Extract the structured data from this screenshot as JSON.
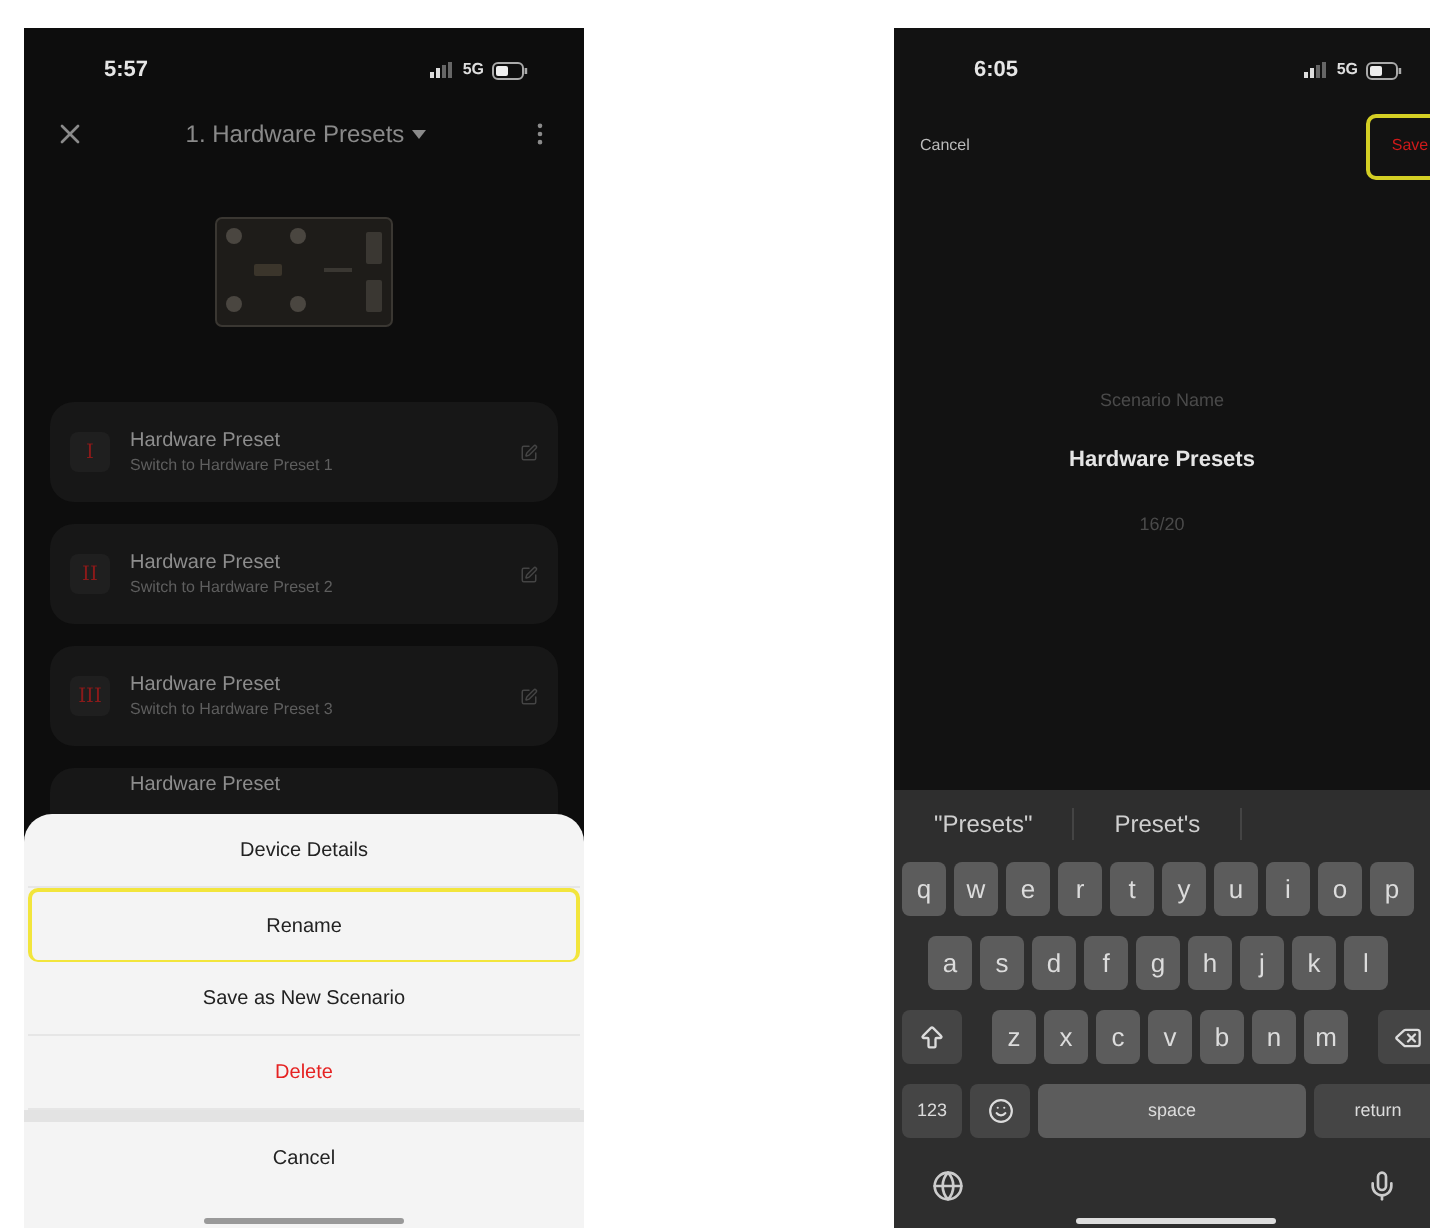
{
  "left_screen": {
    "status": {
      "time": "5:57",
      "network": "5G"
    },
    "header": {
      "title": "1. Hardware Presets"
    },
    "presets": [
      {
        "numeral": "I",
        "title": "Hardware Preset",
        "subtitle": "Switch to Hardware Preset 1"
      },
      {
        "numeral": "II",
        "title": "Hardware Preset",
        "subtitle": "Switch to Hardware Preset 2"
      },
      {
        "numeral": "III",
        "title": "Hardware Preset",
        "subtitle": "Switch to Hardware Preset 3"
      },
      {
        "title": "Hardware Preset"
      }
    ],
    "action_sheet": {
      "items": [
        {
          "label": "Device Details",
          "kind": "normal",
          "selected": false
        },
        {
          "label": "Rename",
          "kind": "normal",
          "selected": true
        },
        {
          "label": "Save as New Scenario",
          "kind": "normal",
          "selected": false
        },
        {
          "label": "Delete",
          "kind": "destructive",
          "selected": false
        }
      ],
      "cancel": "Cancel"
    }
  },
  "right_screen": {
    "status": {
      "time": "6:05",
      "network": "5G"
    },
    "cancel": "Cancel",
    "save": {
      "label": "Save",
      "selected": true
    },
    "field": {
      "label": "Scenario Name",
      "value": "Hardware Presets",
      "counter": "16/20"
    },
    "keyboard": {
      "suggestions": [
        "\"Presets\"",
        "Preset's"
      ],
      "rows": [
        [
          "q",
          "w",
          "e",
          "r",
          "t",
          "y",
          "u",
          "i",
          "o",
          "p"
        ],
        [
          "a",
          "s",
          "d",
          "f",
          "g",
          "h",
          "j",
          "k",
          "l"
        ],
        [
          "z",
          "x",
          "c",
          "v",
          "b",
          "n",
          "m"
        ]
      ],
      "numbers": "123",
      "space": "space",
      "return": "return"
    }
  }
}
